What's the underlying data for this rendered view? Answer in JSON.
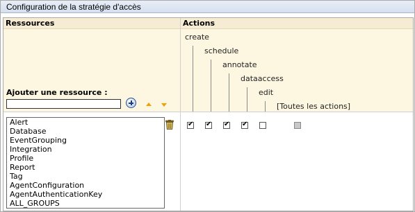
{
  "title": "Configuration de la stratégie d'accès",
  "headers": {
    "resources": "Ressources",
    "actions": "Actions"
  },
  "actions": [
    "create",
    "schedule",
    "annotate",
    "dataaccess",
    "edit",
    "[Toutes les actions]"
  ],
  "add_resource": {
    "label": "Ajouter une ressource :",
    "value": ""
  },
  "resources": [
    "Alert",
    "Database",
    "EventGrouping",
    "Integration",
    "Profile",
    "Report",
    "Tag",
    "AgentConfiguration",
    "AgentAuthenticationKey",
    "ALL_GROUPS"
  ],
  "checkboxes": [
    {
      "name": "create",
      "checked": true
    },
    {
      "name": "schedule",
      "checked": true
    },
    {
      "name": "annotate",
      "checked": true
    },
    {
      "name": "dataaccess",
      "checked": true
    },
    {
      "name": "edit",
      "checked": false
    },
    {
      "name": "all-actions",
      "checked": false,
      "disabled": true
    }
  ],
  "icons": [
    "add-circle-icon",
    "arrow-up-icon",
    "arrow-down-icon",
    "trash-icon"
  ],
  "colors": {
    "header_bg": "#f5ecd3",
    "cream_bg": "#fdf7e2",
    "title_bg": "#d5dfee",
    "arrow": "#f0a000"
  }
}
